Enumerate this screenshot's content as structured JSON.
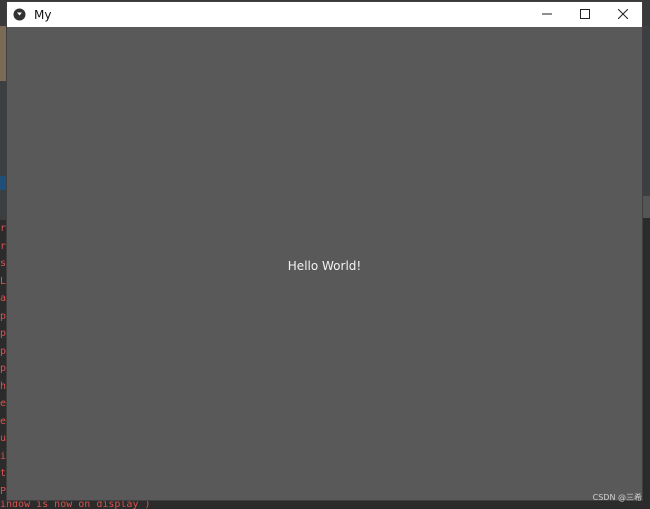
{
  "window": {
    "title": "My",
    "controls": {
      "minimize_icon": "minimize-icon",
      "maximize_icon": "maximize-icon",
      "close_icon": "close-icon"
    },
    "body_text": "Hello World!",
    "background_color": "#595959"
  },
  "background": {
    "console_letters": [
      "r",
      "r",
      "s",
      "L",
      "a",
      "p",
      "p",
      "p",
      "p",
      "h",
      "e",
      "e",
      "u",
      "i",
      "t",
      "P"
    ],
    "console_bottom_line": "indow is now on display )",
    "watermark": "CSDN @三希"
  }
}
